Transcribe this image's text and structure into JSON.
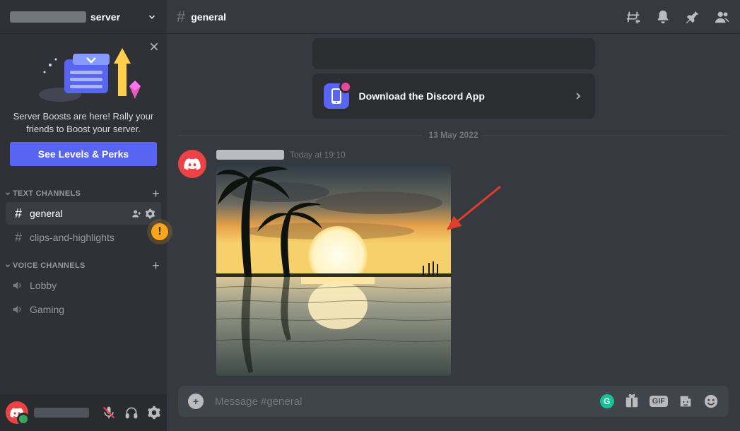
{
  "server": {
    "name_suffix": "server"
  },
  "boost": {
    "text_line1": "Server Boosts are here! Rally your",
    "text_line2": "friends to Boost your server.",
    "button": "See Levels & Perks"
  },
  "categories": {
    "text": {
      "label": "TEXT CHANNELS"
    },
    "voice": {
      "label": "VOICE CHANNELS"
    }
  },
  "channels": {
    "text": [
      {
        "name": "general",
        "active": true
      },
      {
        "name": "clips-and-highlights",
        "active": false
      }
    ],
    "voice": [
      {
        "name": "Lobby"
      },
      {
        "name": "Gaming"
      }
    ]
  },
  "header": {
    "channel": "general"
  },
  "cards": {
    "download": "Download the Discord App"
  },
  "divider_date": "13 May 2022",
  "message": {
    "timestamp": "Today at 19:10"
  },
  "composer": {
    "placeholder": "Message #general",
    "gif": "GIF"
  },
  "warn": "!"
}
